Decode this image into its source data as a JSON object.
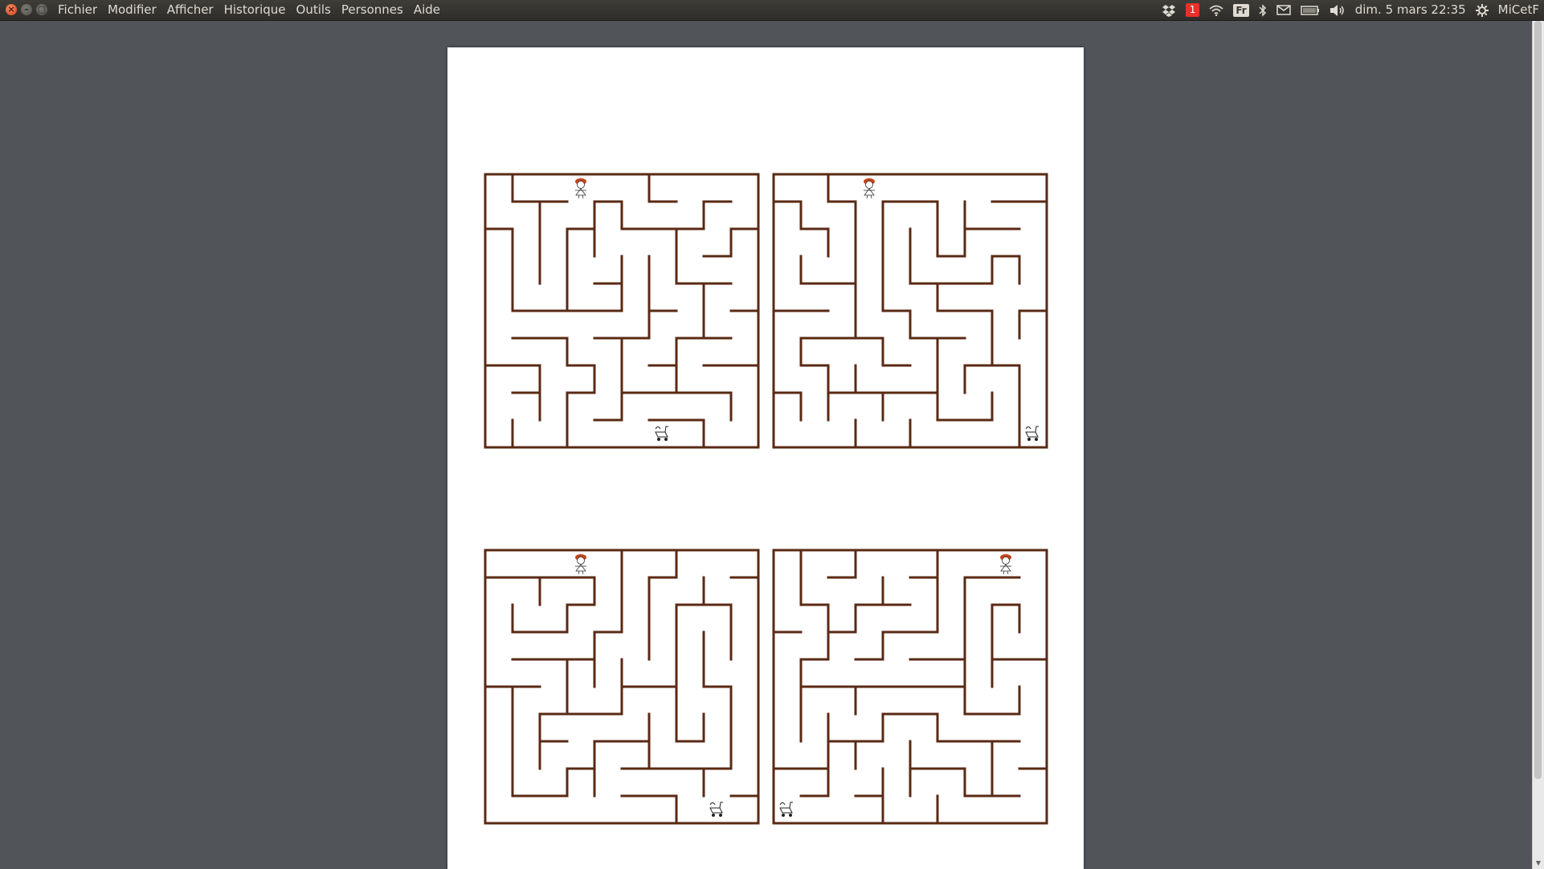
{
  "window": {
    "controls": {
      "close_icon": "×",
      "minimize_icon": "–",
      "maximize_icon": "□"
    }
  },
  "menu": [
    "Fichier",
    "Modifier",
    "Afficher",
    "Historique",
    "Outils",
    "Personnes",
    "Aide"
  ],
  "indicators": {
    "dropbox_icon": "dropbox-icon",
    "notification_count": "1",
    "wifi_icon": "wifi-icon",
    "keyboard_layout": "Fr",
    "bluetooth_icon": "bluetooth-icon",
    "mail_icon": "envelope-icon",
    "battery_icon": "battery-icon",
    "volume_icon": "speaker-icon",
    "clock": "dim. 5 mars 22:35",
    "session_icon": "gear-icon",
    "username": "MiCetF"
  },
  "colors": {
    "maze_wall": "#5a2a14",
    "desktop_bg": "#51555a",
    "page_bg": "#ffffff",
    "badge": "#e5312a"
  },
  "document": {
    "content": "four printable mazes on an A4 page",
    "mazes": [
      {
        "id": "maze-top-left",
        "start_marker": "girl-figure-icon",
        "goal_marker": "stroller-icon"
      },
      {
        "id": "maze-top-right",
        "start_marker": "girl-figure-icon",
        "goal_marker": "stroller-icon"
      },
      {
        "id": "maze-bottom-left",
        "start_marker": "girl-figure-icon",
        "goal_marker": "stroller-icon"
      },
      {
        "id": "maze-bottom-right",
        "start_marker": "girl-figure-icon",
        "goal_marker": "stroller-icon"
      }
    ]
  }
}
